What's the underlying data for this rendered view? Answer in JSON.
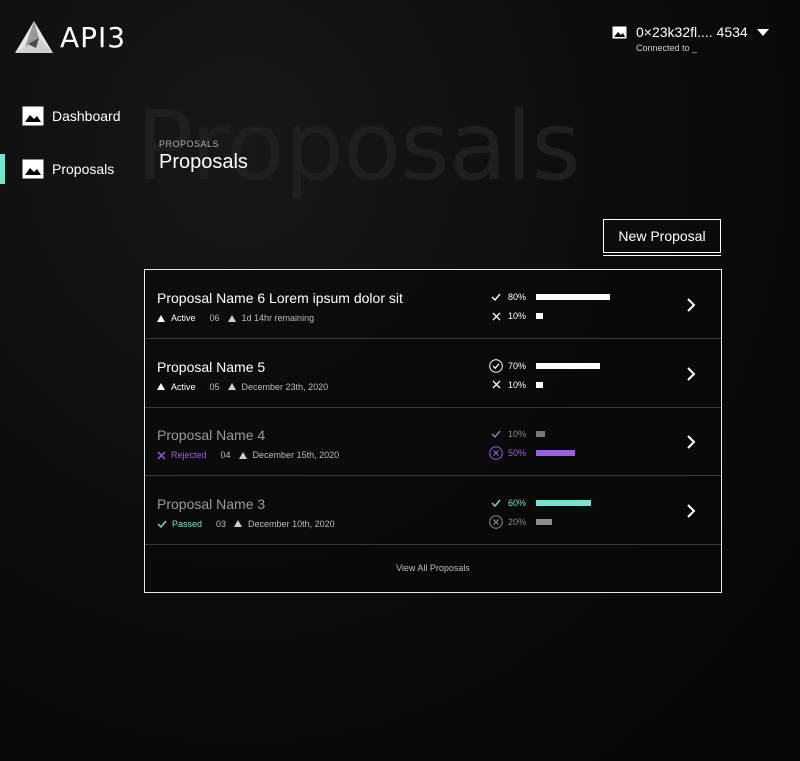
{
  "brand": {
    "name": "API3"
  },
  "wallet": {
    "address": "0×23k32fl.... 4534",
    "status": "Connected to _"
  },
  "sidebar": {
    "items": [
      {
        "label": "Dashboard",
        "active": false
      },
      {
        "label": "Proposals",
        "active": true
      }
    ]
  },
  "page": {
    "background_title": "Proposals",
    "breadcrumb": "PROPOSALS",
    "title": "Proposals",
    "new_button": "New Proposal"
  },
  "colors": {
    "accent_teal": "#7ce3cb",
    "rejected_purple": "#9b5de5",
    "active_white": "#ffffff",
    "muted_grey": "#8c8c8c"
  },
  "proposals": [
    {
      "name": "Proposal Name 6 Lorem ipsum dolor sit",
      "status": "Active",
      "number": "06",
      "deadline": "1d 14hr remaining",
      "for": {
        "label": "80%",
        "value": 80,
        "icon": "check-icon"
      },
      "against": {
        "label": "10%",
        "value": 10,
        "icon": "x-icon"
      },
      "dimmed": false
    },
    {
      "name": "Proposal Name 5",
      "status": "Active",
      "number": "05",
      "deadline": "December 23th, 2020",
      "for": {
        "label": "70%",
        "value": 70,
        "icon": "check-circle-icon"
      },
      "against": {
        "label": "10%",
        "value": 10,
        "icon": "x-icon"
      },
      "dimmed": false
    },
    {
      "name": "Proposal Name 4",
      "status": "Rejected",
      "number": "04",
      "deadline": "December 15th, 2020",
      "for": {
        "label": "10%",
        "value": 10,
        "icon": "check-icon"
      },
      "against": {
        "label": "50%",
        "value": 50,
        "icon": "x-circle-icon"
      },
      "dimmed": true
    },
    {
      "name": "Proposal Name 3",
      "status": "Passed",
      "number": "03",
      "deadline": "December 10th, 2020",
      "for": {
        "label": "60%",
        "value": 60,
        "icon": "check-icon"
      },
      "against": {
        "label": "20%",
        "value": 20,
        "icon": "x-circle-icon"
      },
      "dimmed": true
    }
  ],
  "view_all": "View All Proposals"
}
